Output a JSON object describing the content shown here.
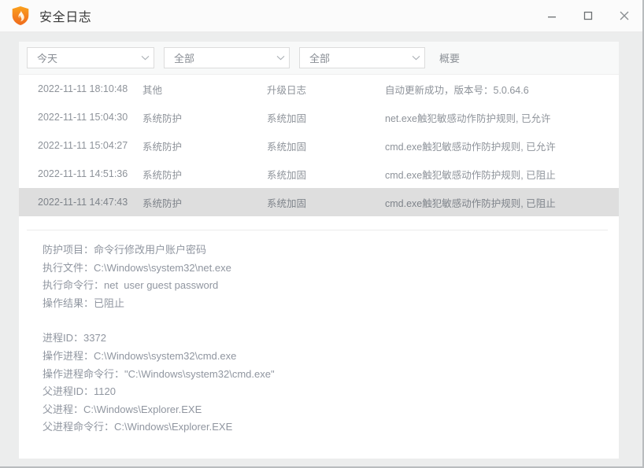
{
  "window": {
    "title": "安全日志",
    "icon": "shield-flame-icon",
    "accent_color": "#f08020",
    "controls": {
      "minimize": "minimize-icon",
      "maximize": "maximize-icon",
      "close": "close-icon"
    }
  },
  "filters": {
    "date_range": {
      "value": "今天",
      "icon": "chevron-down-icon"
    },
    "log_type": {
      "value": "全部",
      "icon": "chevron-down-icon"
    },
    "log_action": {
      "value": "全部",
      "icon": "chevron-down-icon"
    },
    "summary_header": "概要"
  },
  "log_table": {
    "rows": [
      {
        "time": "2022-11-11 18:10:48",
        "type": "其他",
        "subtype": "升级日志",
        "summary": "自动更新成功，版本号：5.0.64.6",
        "selected": false
      },
      {
        "time": "2022-11-11 15:04:30",
        "type": "系统防护",
        "subtype": "系统加固",
        "summary": "net.exe触犯敏感动作防护规则, 已允许",
        "selected": false
      },
      {
        "time": "2022-11-11 15:04:27",
        "type": "系统防护",
        "subtype": "系统加固",
        "summary": "cmd.exe触犯敏感动作防护规则, 已允许",
        "selected": false
      },
      {
        "time": "2022-11-11 14:51:36",
        "type": "系统防护",
        "subtype": "系统加固",
        "summary": "cmd.exe触犯敏感动作防护规则, 已阻止",
        "selected": false
      },
      {
        "time": "2022-11-11 14:47:43",
        "type": "系统防护",
        "subtype": "系统加固",
        "summary": "cmd.exe触犯敏感动作防护规则, 已阻止",
        "selected": true
      }
    ]
  },
  "detail": {
    "group1": [
      "防护项目：命令行修改用户账户密码",
      "执行文件：C:\\Windows\\system32\\net.exe",
      "执行命令行：net  user guest password",
      "操作结果：已阻止"
    ],
    "group2": [
      "进程ID：3372",
      "操作进程：C:\\Windows\\system32\\cmd.exe",
      "操作进程命令行：\"C:\\Windows\\system32\\cmd.exe\"",
      "父进程ID：1120",
      "父进程：C:\\Windows\\Explorer.EXE",
      "父进程命令行：C:\\Windows\\Explorer.EXE"
    ]
  }
}
